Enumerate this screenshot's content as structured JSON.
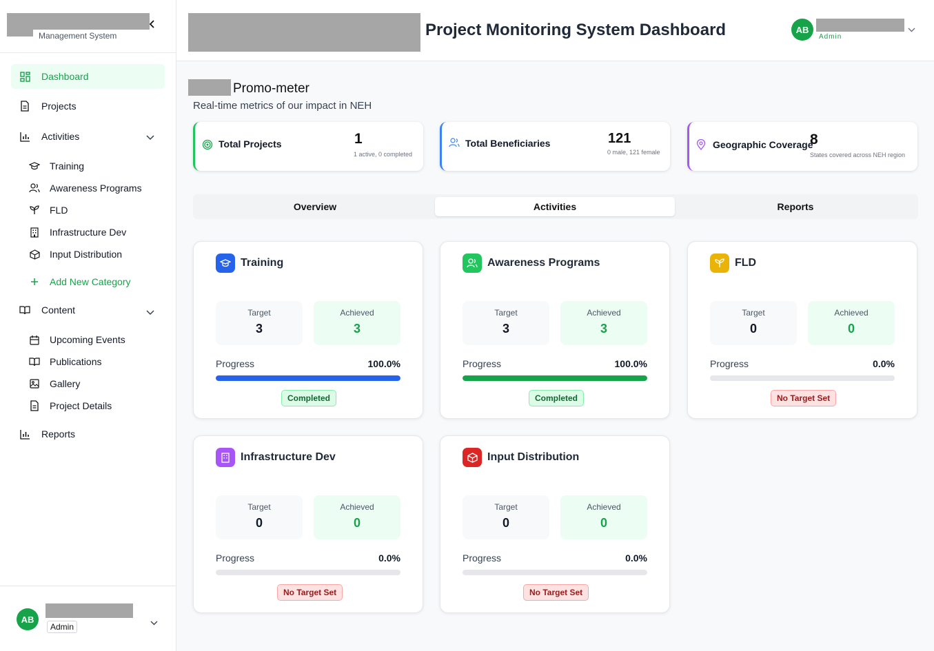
{
  "sidebar": {
    "subtitle": "Management System",
    "nav": {
      "dashboard": "Dashboard",
      "projects": "Projects",
      "activities": "Activities",
      "training": "Training",
      "awareness": "Awareness Programs",
      "fld": "FLD",
      "infrastructure": "Infrastructure Dev",
      "input_distribution": "Input Distribution",
      "add_category": "Add New Category",
      "content": "Content",
      "upcoming_events": "Upcoming Events",
      "publications": "Publications",
      "gallery": "Gallery",
      "project_details": "Project Details",
      "reports": "Reports"
    },
    "user": {
      "initials": "AB",
      "role": "Admin"
    }
  },
  "header": {
    "title": "Project Monitoring System Dashboard",
    "user": {
      "initials": "AB",
      "role": "Admin"
    }
  },
  "main": {
    "promo_title": "Promo-meter",
    "promo_subtitle": "Real-time metrics of our impact in NEH",
    "stats": [
      {
        "label": "Total Projects",
        "value": "1",
        "note": "1 active, 0 completed",
        "color": "#22c55e"
      },
      {
        "label": "Total Beneficiaries",
        "value": "121",
        "note": "0 male, 121 female",
        "color": "#3b82f6"
      },
      {
        "label": "Geographic Coverage",
        "value": "8",
        "note": "States covered across NEH region",
        "color": "#a855f7"
      }
    ],
    "tabs": [
      "Overview",
      "Activities",
      "Reports"
    ],
    "active_tab": "Activities",
    "labels": {
      "target": "Target",
      "achieved": "Achieved",
      "progress": "Progress"
    },
    "cards": [
      {
        "title": "Training",
        "target": "3",
        "achieved": "3",
        "progress_text": "100.0%",
        "progress": 1.0,
        "status": "Completed",
        "color": "#2563eb"
      },
      {
        "title": "Awareness Programs",
        "target": "3",
        "achieved": "3",
        "progress_text": "100.0%",
        "progress": 1.0,
        "status": "Completed",
        "color": "#16a34a"
      },
      {
        "title": "FLD",
        "target": "0",
        "achieved": "0",
        "progress_text": "0.0%",
        "progress": 0.0,
        "status": "No Target Set",
        "color": "#eab308"
      },
      {
        "title": "Infrastructure Dev",
        "target": "0",
        "achieved": "0",
        "progress_text": "0.0%",
        "progress": 0.0,
        "status": "No Target Set",
        "color": "#9333ea"
      },
      {
        "title": "Input Distribution",
        "target": "0",
        "achieved": "0",
        "progress_text": "0.0%",
        "progress": 0.0,
        "status": "No Target Set",
        "color": "#dc2626"
      }
    ]
  }
}
